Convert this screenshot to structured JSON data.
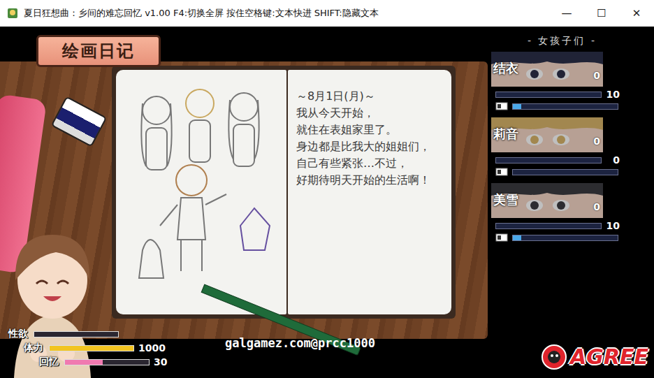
{
  "window": {
    "title": "夏日狂想曲：乡间的难忘回忆 v1.00 F4:切换全屏 按住空格键:文本快进 SHIFT:隐藏文本",
    "controls": [
      "—",
      "☐",
      "✕"
    ]
  },
  "header": {
    "title": "绘画日记"
  },
  "diary": {
    "date": "～8月1日(月)～",
    "lines": [
      "我从今天开始，",
      "就住在表姐家里了。",
      "身边都是比我大的姐姐们，",
      "自己有些紧张…不过，",
      "好期待明天开始的生活啊！"
    ]
  },
  "girls_panel": {
    "title": "- 女孩子们 -",
    "girls": [
      {
        "name": "结衣",
        "value": "0",
        "reading": "10",
        "level": 0,
        "sub_level": 0.08,
        "color": "#2b2f48"
      },
      {
        "name": "莉音",
        "value": "0",
        "reading": "0",
        "level": 0,
        "sub_level": 0,
        "color": "#d9b56a"
      },
      {
        "name": "美雪",
        "value": "0",
        "reading": "10",
        "level": 0,
        "sub_level": 0.08,
        "color": "#3b3b40"
      }
    ]
  },
  "stats": [
    {
      "label": "性欲",
      "level": 0,
      "color": "#b06ad0"
    },
    {
      "label": "体力",
      "reading": "1000",
      "level": 1,
      "color": "#f2c420"
    },
    {
      "label": "回忆",
      "reading": "30",
      "level": 0.45,
      "color": "#f07ab0"
    }
  ],
  "watermark": "galgamez.com@prcc1000",
  "logo": "AGREE"
}
